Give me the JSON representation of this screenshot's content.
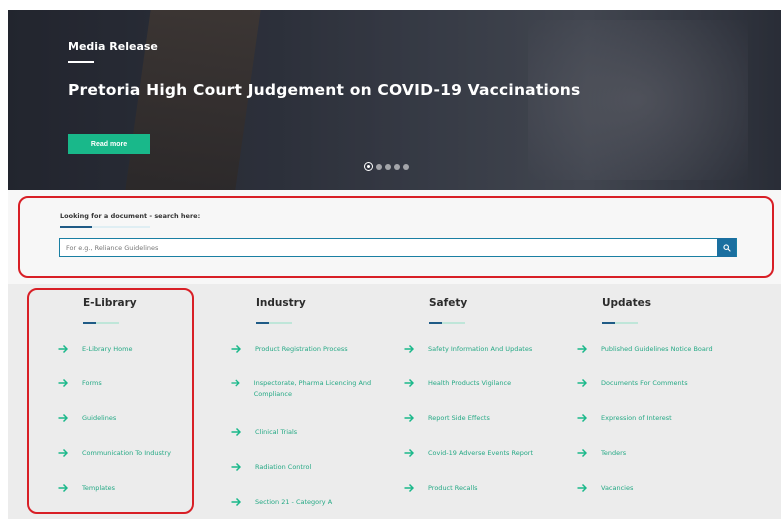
{
  "hero": {
    "eyebrow": "Media Release",
    "title": "Pretoria High Court Judgement on COVID-19 Vaccinations",
    "button_label": "Read more",
    "slides_total": 5,
    "slide_active": 1
  },
  "search": {
    "label": "Looking for a document - search here:",
    "placeholder": "For e.g., Reliance Guidelines",
    "button_icon": "search-icon"
  },
  "columns": [
    {
      "title": "E-Library",
      "items": [
        "E-Library Home",
        "Forms",
        "Guidelines",
        "Communication To Industry",
        "Templates"
      ]
    },
    {
      "title": "Industry",
      "items": [
        "Product Registration Process",
        "Inspectorate, Pharma Licencing And Compliance",
        "Clinical Trials",
        "Radiation Control",
        "Section 21 - Category A"
      ]
    },
    {
      "title": "Safety",
      "items": [
        "Safety Information And Updates",
        "Health Products Vigilance",
        "Report Side Effects",
        "Covid-19 Adverse Events Report",
        "Product Recalls"
      ]
    },
    {
      "title": "Updates",
      "items": [
        "Published Guidelines Notice Board",
        "Documents For Comments",
        "Expression of Interest",
        "Tenders",
        "Vacancies"
      ]
    }
  ],
  "colors": {
    "accent_green": "#19b88a",
    "link_green": "#25a985",
    "navy": "#1f5b86",
    "highlight_red": "#d81f26"
  }
}
